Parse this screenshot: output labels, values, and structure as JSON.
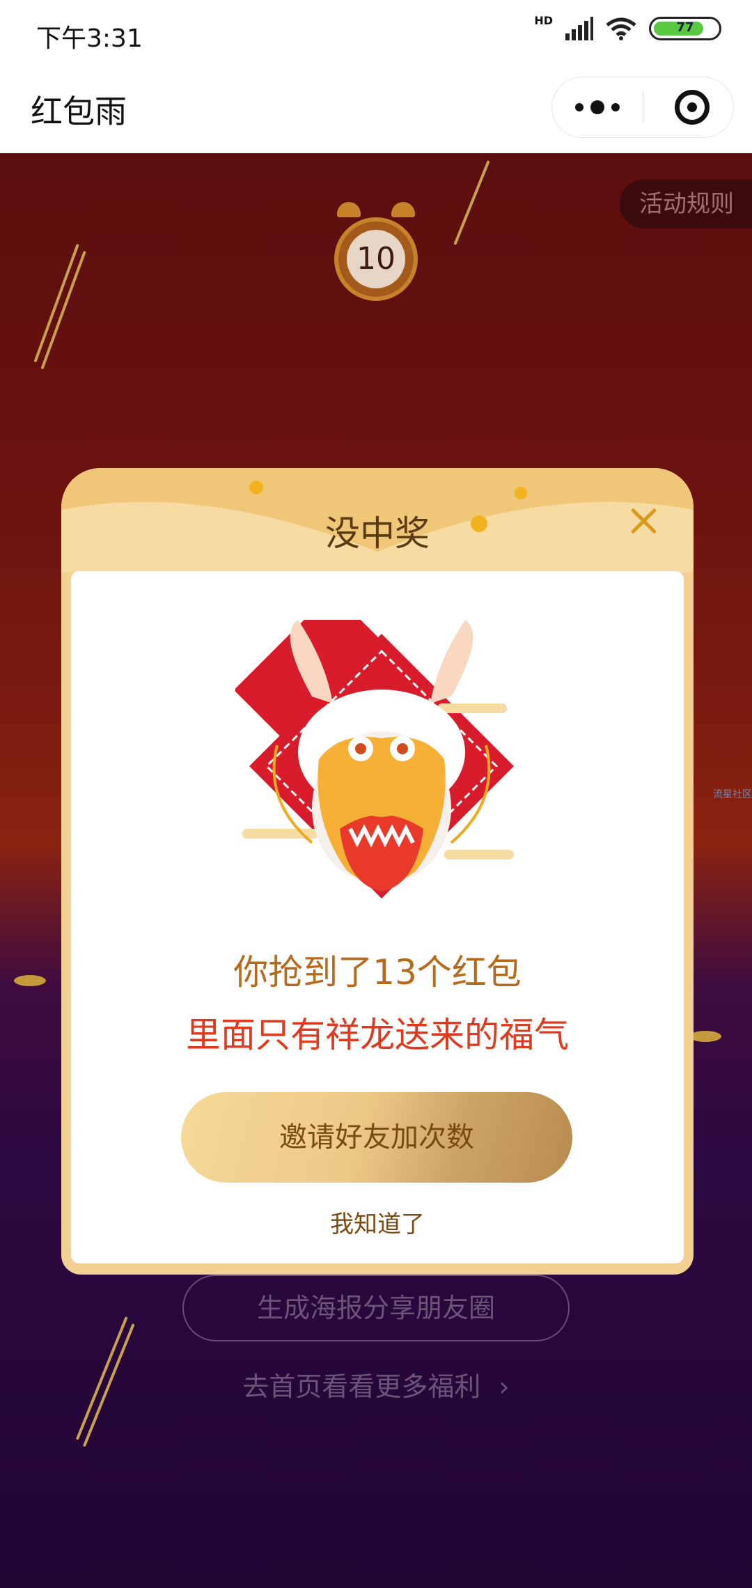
{
  "status_bar": {
    "time": "下午3:31",
    "network": "HD",
    "battery": "77"
  },
  "nav": {
    "title": "红包雨"
  },
  "game": {
    "rules_label": "活动规则",
    "countdown": "10",
    "share_poster_label": "生成海报分享朋友圈",
    "home_link_label": "去首页看看更多福利",
    "home_link_arrow": "›",
    "watermark": "流星社区"
  },
  "modal": {
    "title": "没中奖",
    "result_line1": "你抢到了13个红包",
    "result_line2": "里面只有祥龙送来的福气",
    "invite_label": "邀请好友加次数",
    "dismiss_label": "我知道了"
  },
  "colors": {
    "accent_gold": "#f3d194",
    "text_brown": "#b56a1c",
    "text_red": "#e03a1e",
    "bg_red": "#6a1210",
    "bg_purple": "#2c0840"
  }
}
